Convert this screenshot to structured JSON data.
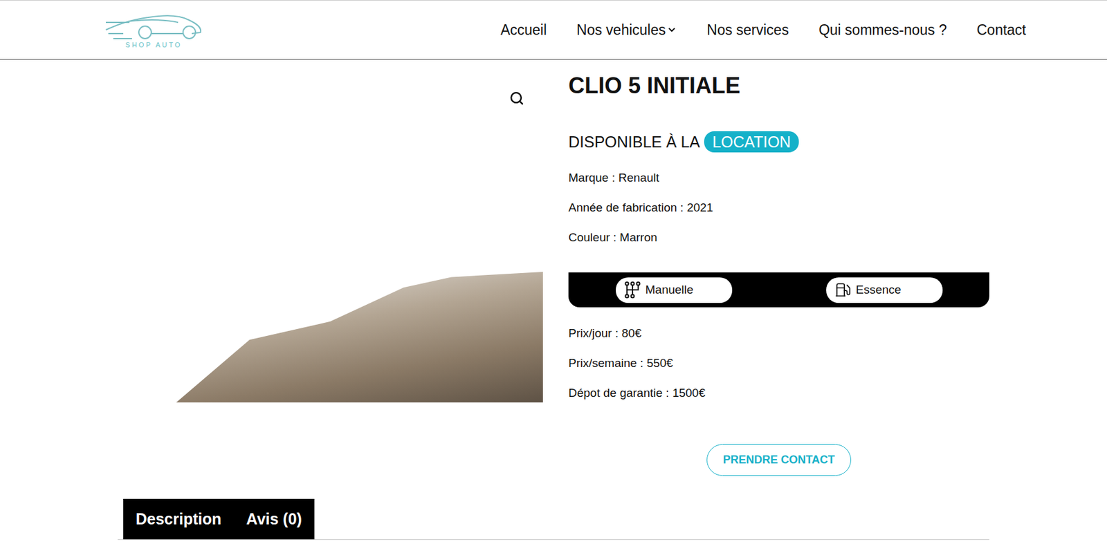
{
  "header": {
    "logo": "SHOP AUTO",
    "nav": [
      {
        "label": "Accueil",
        "dropdown": false
      },
      {
        "label": "Nos vehicules",
        "dropdown": true
      },
      {
        "label": "Nos services",
        "dropdown": false
      },
      {
        "label": "Qui sommes-nous ?",
        "dropdown": false
      },
      {
        "label": "Contact",
        "dropdown": false
      }
    ]
  },
  "product": {
    "title": "CLIO 5 INITIALE",
    "availability": {
      "prefix": "DISPONIBLE À LA",
      "badge": "LOCATION"
    },
    "specs": [
      "Marque : Renault",
      "Année de fabrication : 2021",
      "Couleur : Marron"
    ],
    "features": [
      {
        "kind": "gearbox",
        "label": "Manuelle"
      },
      {
        "kind": "fuel",
        "label": "Essence"
      }
    ],
    "prices": [
      "Prix/jour : 80€",
      "Prix/semaine : 550€",
      "Dépot de garantie : 1500€"
    ],
    "button": "PRENDRE CONTACT"
  },
  "tabs": [
    {
      "label": "Description"
    },
    {
      "label": "Avis (0)"
    }
  ]
}
